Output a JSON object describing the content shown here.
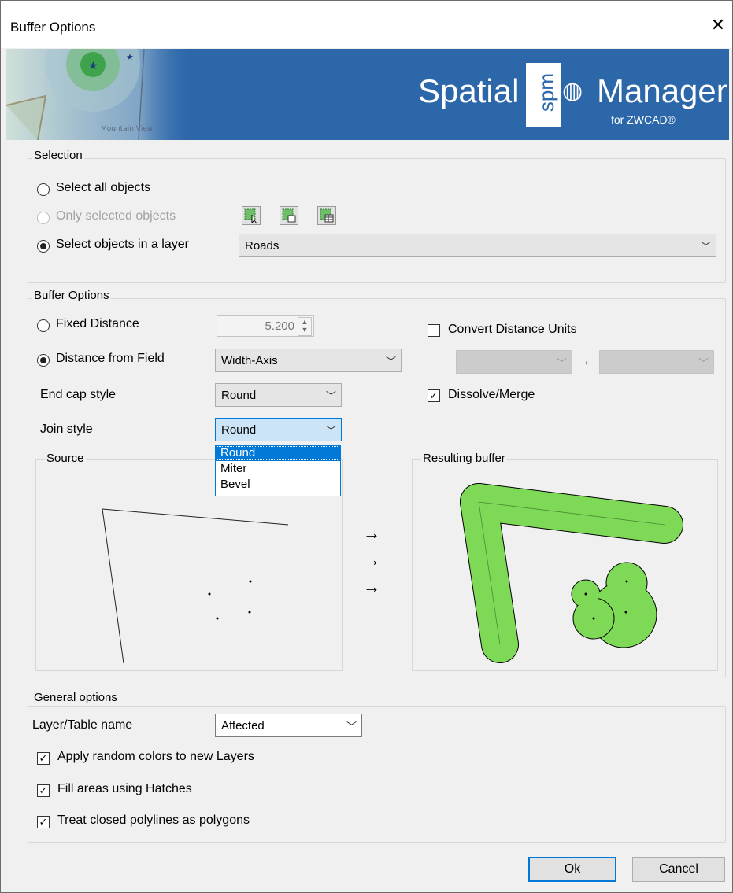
{
  "window": {
    "title": "Buffer Options",
    "close_glyph": "✕"
  },
  "banner": {
    "brand_left": "Spatial",
    "brand_right": "Manager",
    "brand_sub": "for ZWCAD®",
    "logo_text": "spm",
    "map_label": "Mountain View",
    "accent": "#2c67aa"
  },
  "selection": {
    "label": "Selection",
    "select_all": "Select all objects",
    "only_selected": "Only selected objects",
    "in_layer": "Select objects in a layer",
    "layer_value": "Roads",
    "icon_buttons": [
      "select-objects-icon",
      "select-by-attributes-icon",
      "select-from-table-icon"
    ]
  },
  "buffer": {
    "label": "Buffer Options",
    "fixed_distance": "Fixed Distance",
    "fixed_value": "5.200",
    "distance_from_field": "Distance from Field",
    "field_value": "Width-Axis",
    "convert_units": "Convert Distance Units",
    "units_arrow": "→",
    "dissolve": "Dissolve/Merge",
    "end_cap_label": "End cap style",
    "end_cap_value": "Round",
    "join_label": "Join style",
    "join_value": "Round",
    "join_options": [
      "Round",
      "Miter",
      "Bevel"
    ],
    "source_label": "Source",
    "result_label": "Resulting buffer",
    "arrows": [
      "→",
      "→",
      "→"
    ],
    "buffer_fill": "#7ed957"
  },
  "general": {
    "label": "General options",
    "layer_table_label": "Layer/Table name",
    "layer_table_value": "Affected",
    "random_colors": "Apply random colors to new Layers",
    "fill_hatches": "Fill areas using Hatches",
    "treat_closed": "Treat closed polylines as polygons"
  },
  "footer": {
    "ok": "Ok",
    "cancel": "Cancel"
  }
}
